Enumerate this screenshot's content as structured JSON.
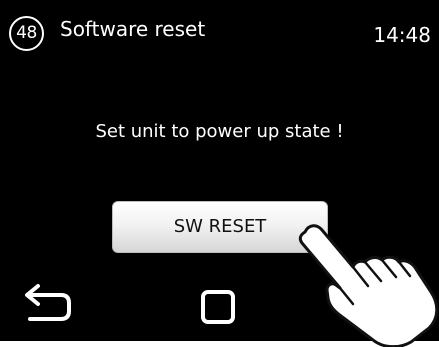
{
  "header": {
    "page_number": "48",
    "title": "Software reset",
    "time": "14:48"
  },
  "main": {
    "message": "Set unit to power up state !",
    "reset_button_label": "SW RESET"
  },
  "navigation": {
    "back_icon": "back-arrow-icon",
    "home_icon": "home-square-icon"
  },
  "overlay": {
    "pointer_icon": "pointing-hand-icon"
  },
  "colors": {
    "screen_background": "#000000",
    "text": "#ffffff",
    "button_top": "#ffffff",
    "button_bottom": "#d6d6d6"
  }
}
